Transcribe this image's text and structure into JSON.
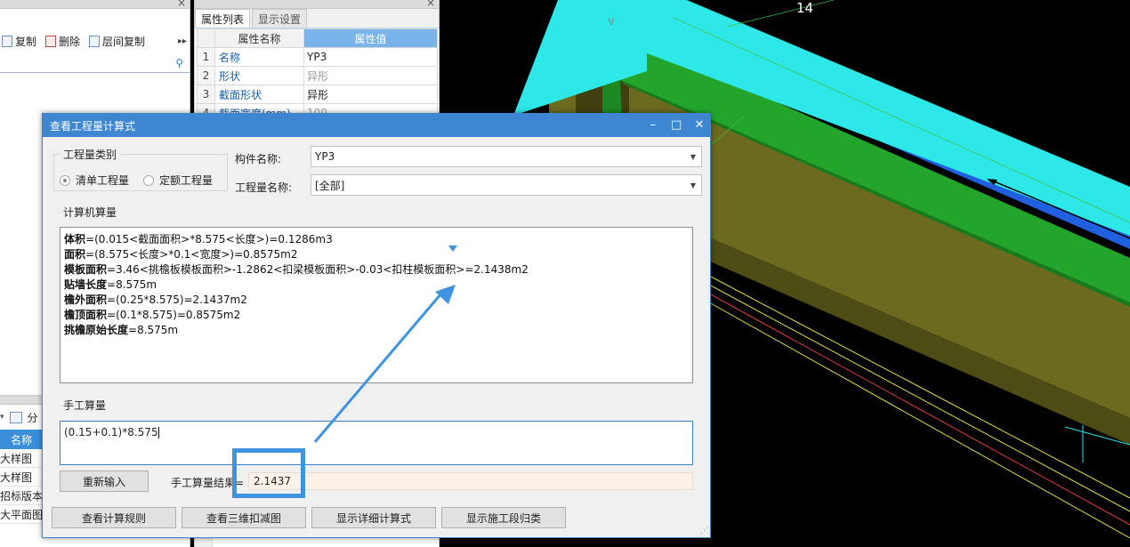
{
  "left_panel": {
    "toolbar": {
      "copy": "复制",
      "delete": "删除",
      "floor_copy": "层间复制",
      "more": "▸▸"
    },
    "lower_toolbar": {
      "label": "分"
    },
    "name_column": "名称",
    "rows": [
      "大样图",
      "大样图",
      "招标版本杯",
      "大平面图"
    ]
  },
  "prop_panel": {
    "tabs": [
      "属性列表",
      "显示设置"
    ],
    "headers": {
      "name": "属性名称",
      "value": "属性值"
    },
    "rows": [
      {
        "idx": "1",
        "name": "名称",
        "value": "YP3"
      },
      {
        "idx": "2",
        "name": "形状",
        "value": "异形"
      },
      {
        "idx": "3",
        "name": "截面形状",
        "value": "异形"
      },
      {
        "idx": "4",
        "name": "截面宽度(mm)",
        "value": "100"
      }
    ]
  },
  "viewport": {
    "axis_label": "14"
  },
  "dialog": {
    "title": "查看工程量计算式",
    "controls": {
      "minimize": "–",
      "maximize": "□",
      "close": "✕"
    },
    "qty_type": {
      "title": "工程量类别",
      "option_bill": "清单工程量",
      "option_quota": "定额工程量",
      "selected": "清单工程量"
    },
    "component_label": "构件名称:",
    "component_value": "YP3",
    "qty_name_label": "工程量名称:",
    "qty_name_value": "[全部]",
    "computer_calc_title": "计算机算量",
    "calc_lines": [
      {
        "name": "体积",
        "expr": "=(0.015<截面面积>*8.575<长度>)=0.1286m3"
      },
      {
        "name": "面积",
        "expr": "=(8.575<长度>*0.1<宽度>)=0.8575m2"
      },
      {
        "name": "模板面积",
        "expr": "=3.46<挑檐板模板面积>-1.2862<扣梁模板面积>-0.03<扣柱模板面积>=2.1438m2"
      },
      {
        "name": "贴墙长度",
        "expr": "=8.575m"
      },
      {
        "name": "檐外面积",
        "expr": "=(0.25*8.575)=2.1437m2"
      },
      {
        "name": "檐顶面积",
        "expr": "=(0.1*8.575)=0.8575m2"
      },
      {
        "name": "挑檐原始长度",
        "expr": "=8.575m"
      }
    ],
    "manual_title": "手工算量",
    "manual_input": "(0.15+0.1)*8.575",
    "reenter_button": "重新输入",
    "manual_result_label": "手工算量结果=",
    "manual_result_value": "2.1437",
    "buttons": [
      "查看计算规则",
      "查看三维扣减图",
      "显示详细计算式",
      "显示施工段归类"
    ]
  },
  "colors": {
    "accent": "#3f86d1",
    "slab_cyan": "#2ee8e8",
    "beam_blue": "#1f5fe0",
    "beam_green": "#23a52b",
    "wall_olive": "#6b6a1e",
    "annotation_blue": "#3f93e0"
  }
}
